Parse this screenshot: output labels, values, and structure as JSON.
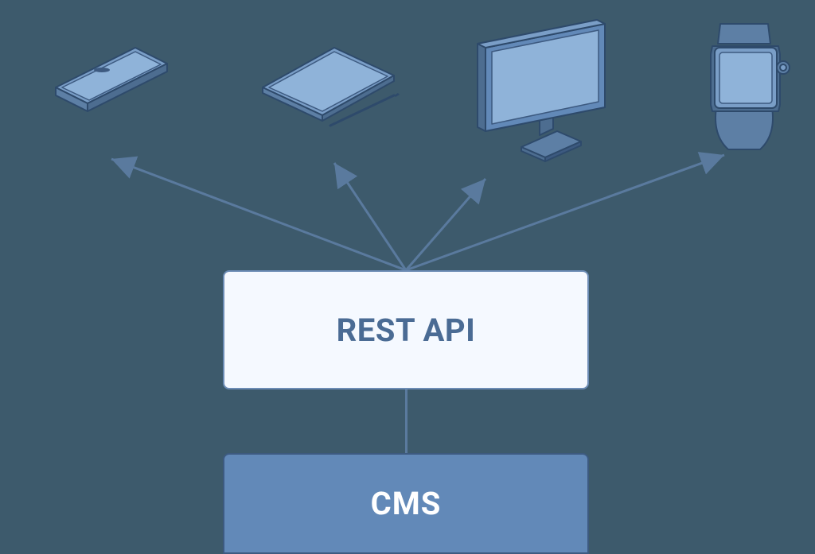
{
  "diagram": {
    "rest_api_label": "REST API",
    "cms_label": "CMS",
    "devices": [
      {
        "id": "phone",
        "label": "Smartphone"
      },
      {
        "id": "tablet",
        "label": "Tablet"
      },
      {
        "id": "monitor",
        "label": "Desktop Monitor"
      },
      {
        "id": "watch",
        "label": "Smartwatch"
      }
    ],
    "colors": {
      "bg": "#3d5a6c",
      "box_light": "#f5f9ff",
      "box_dark": "#6289b8",
      "stroke": "#5a7a9e",
      "device_fill": "#7a9ec7",
      "device_stroke": "#2e4a6b",
      "text_primary": "#4a6b94",
      "text_light": "#ffffff"
    }
  }
}
